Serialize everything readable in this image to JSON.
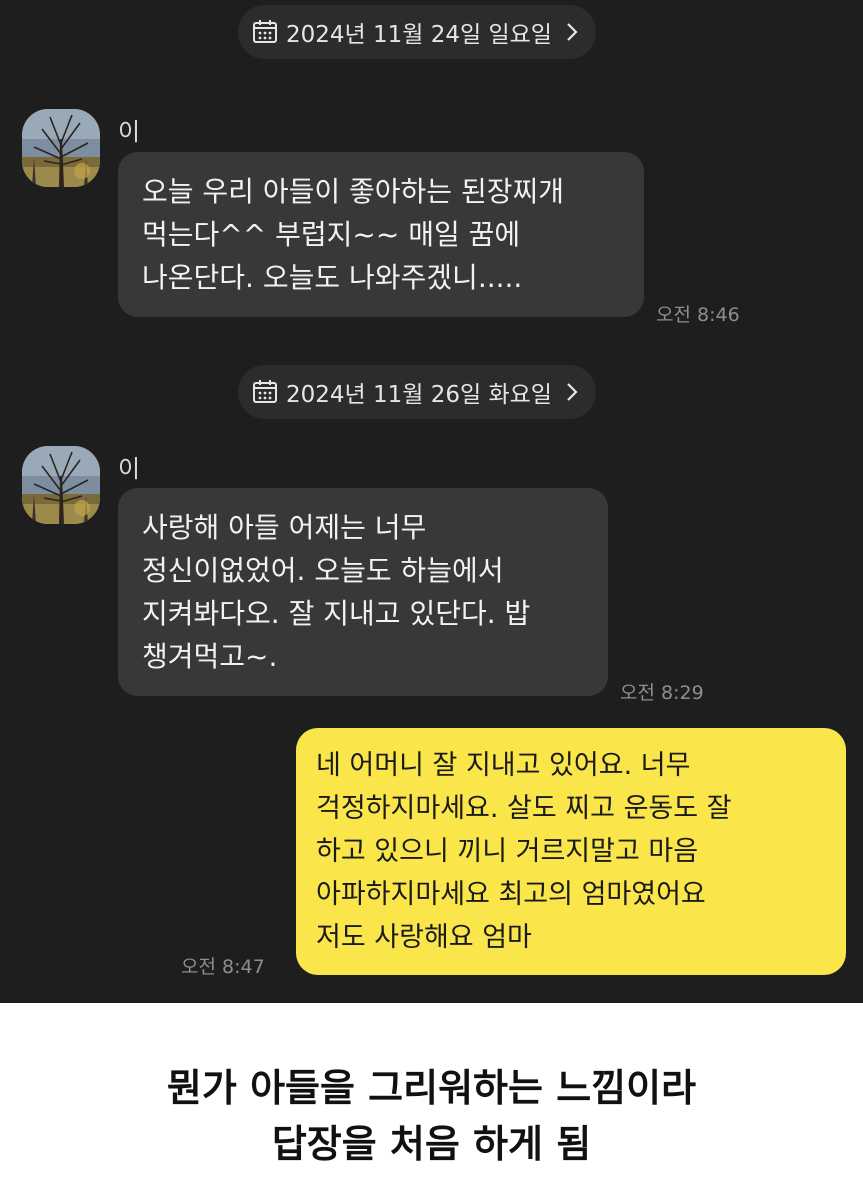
{
  "chat": {
    "date_1": "2024년 11월 24일 일요일",
    "date_2": "2024년 11월 26일 화요일",
    "messages": [
      {
        "sender": "이",
        "text": "오늘 우리 아들이 좋아하는 된장찌개\n먹는다^^ 부럽지~~ 매일 꿈에\n나온단다. 오늘도 나와주겠니.....",
        "time": "오전 8:46"
      },
      {
        "sender": "이",
        "text": "사랑해 아들 어제는 너무\n정신이없었어. 오늘도 하늘에서\n지켜봐다오. 잘 지내고 있단다. 밥\n챙겨먹고~.",
        "time": "오전 8:29"
      },
      {
        "sender": "me",
        "text": "네 어머니 잘 지내고 있어요. 너무\n걱정하지마세요. 살도 찌고 운동도 잘\n하고 있으니 끼니 거르지말고 마음\n아파하지마세요 최고의 엄마였어요\n저도 사랑해요 엄마",
        "time": "오전 8:47"
      }
    ]
  },
  "caption": "뭔가 아들을 그리워하는 느낌이라\n답장을 처음 하게 됨",
  "colors": {
    "background": "#1e1e1e",
    "incoming_bubble": "#383838",
    "outgoing_bubble": "#fae64b",
    "date_chip": "#2c2c2e"
  },
  "icons": [
    "calendar-icon",
    "chevron-right-icon",
    "avatar-tree-photo"
  ]
}
